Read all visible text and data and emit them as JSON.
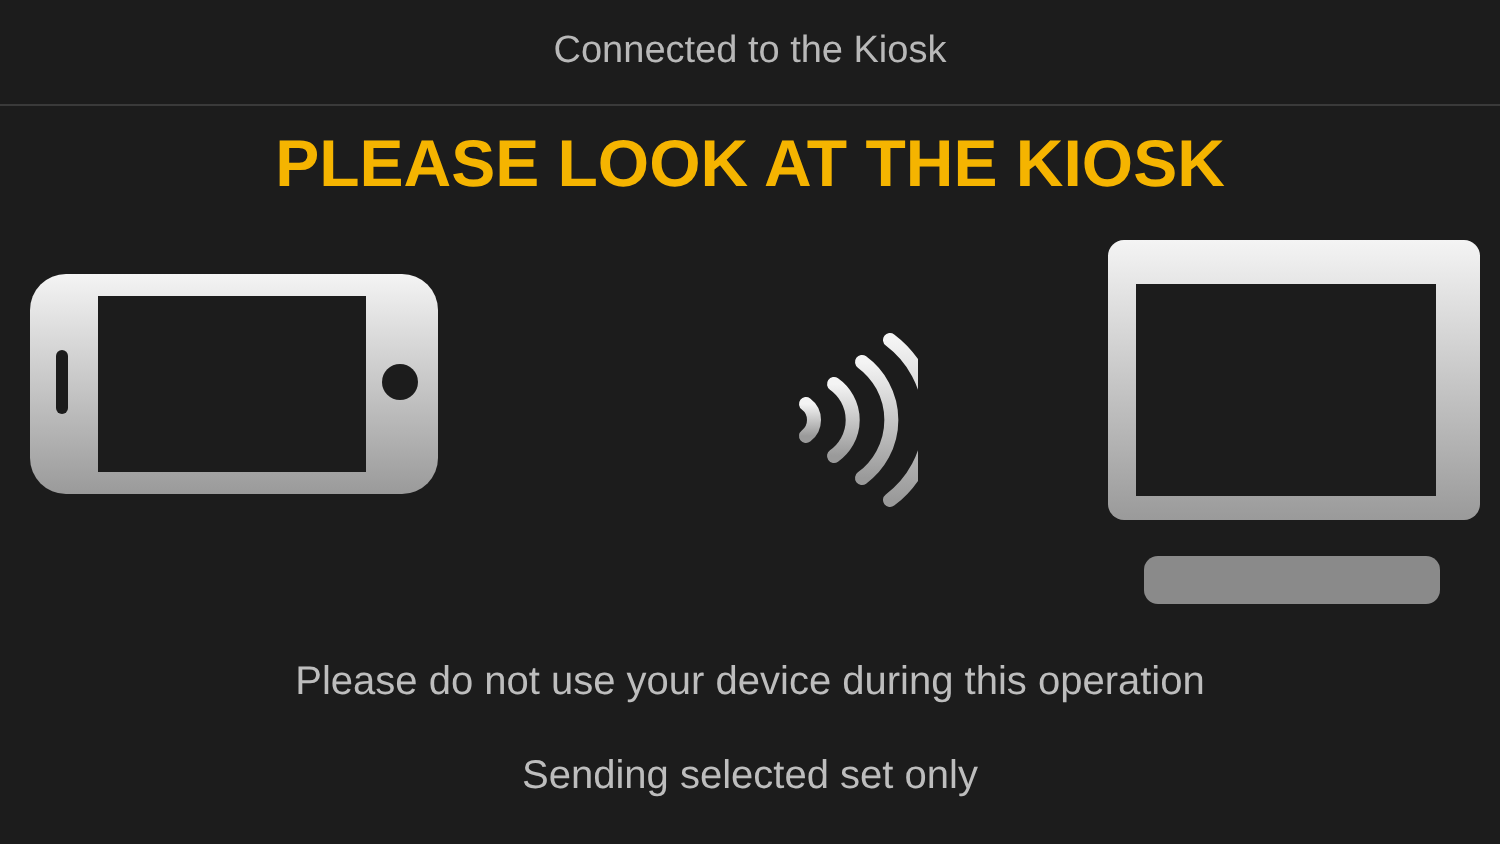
{
  "header": {
    "title": "Connected to the Kiosk"
  },
  "headline": "PLEASE LOOK AT THE KIOSK",
  "messages": [
    "Please do not use your device during this operation",
    "Sending selected set only"
  ]
}
